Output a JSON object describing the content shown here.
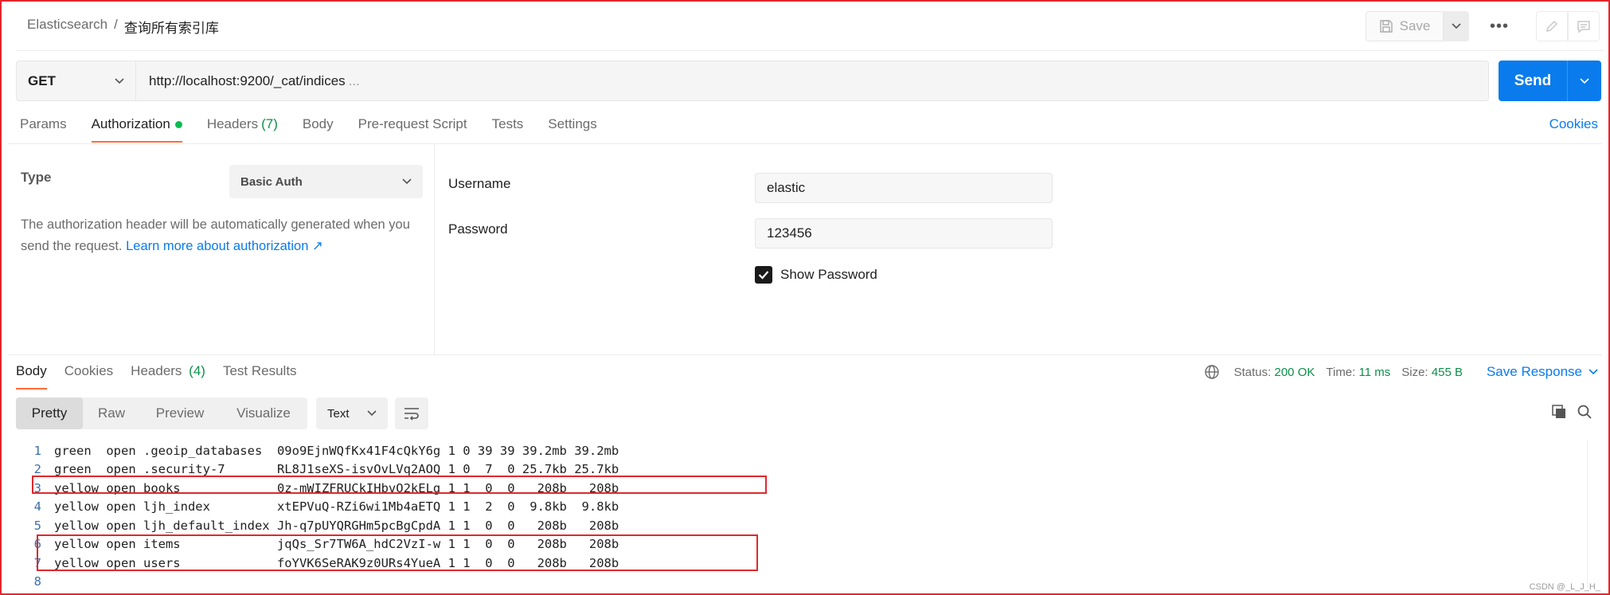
{
  "header": {
    "collection": "Elasticsearch",
    "separator": "/",
    "request_name": "查询所有索引库",
    "save_label": "Save",
    "more_label": "•••"
  },
  "request": {
    "method": "GET",
    "url": "http://localhost:9200/_cat/indices",
    "url_ellipsis": "...",
    "send_label": "Send"
  },
  "req_tabs": [
    {
      "label": "Params"
    },
    {
      "label": "Authorization",
      "active": true,
      "dot": true
    },
    {
      "label": "Headers",
      "count": "(7)"
    },
    {
      "label": "Body"
    },
    {
      "label": "Pre-request Script"
    },
    {
      "label": "Tests"
    },
    {
      "label": "Settings"
    }
  ],
  "cookies_label": "Cookies",
  "auth": {
    "type_label": "Type",
    "type_value": "Basic Auth",
    "description": "The authorization header will be automatically generated when you send the request. ",
    "learn_more": "Learn more about authorization ↗",
    "username_label": "Username",
    "username_value": "elastic",
    "password_label": "Password",
    "password_value": "123456",
    "show_password_label": "Show Password",
    "show_password_checked": true
  },
  "response": {
    "tabs": [
      {
        "label": "Body",
        "active": true
      },
      {
        "label": "Cookies"
      },
      {
        "label": "Headers",
        "count": "(4)"
      },
      {
        "label": "Test Results"
      }
    ],
    "status_label": "Status:",
    "status_value": "200 OK",
    "time_label": "Time:",
    "time_value": "11 ms",
    "size_label": "Size:",
    "size_value": "455 B",
    "save_response_label": "Save Response",
    "views": [
      "Pretty",
      "Raw",
      "Preview",
      "Visualize"
    ],
    "active_view": "Pretty",
    "format": "Text",
    "lines": [
      {
        "n": "1",
        "text": "green  open .geoip_databases  09o9EjnWQfKx41F4cQkY6g 1 0 39 39 39.2mb 39.2mb"
      },
      {
        "n": "2",
        "text": "green  open .security-7       RL8J1seXS-isvOvLVq2AOQ 1 0  7  0 25.7kb 25.7kb"
      },
      {
        "n": "3",
        "text": "yellow open books             0z-mWIZFRUCkIHbvO2kELg 1 1  0  0   208b   208b"
      },
      {
        "n": "4",
        "text": "yellow open ljh_index         xtEPVuQ-RZi6wi1Mb4aETQ 1 1  2  0  9.8kb  9.8kb"
      },
      {
        "n": "5",
        "text": "yellow open ljh_default_index Jh-q7pUYQRGHm5pcBgCpdA 1 1  0  0   208b   208b"
      },
      {
        "n": "6",
        "text": "yellow open items             jqQs_Sr7TW6A_hdC2VzI-w 1 1  0  0   208b   208b"
      },
      {
        "n": "7",
        "text": "yellow open users             foYVK6SeRAK9z0URs4YueA 1 1  0  0   208b   208b"
      },
      {
        "n": "8",
        "text": ""
      }
    ]
  },
  "watermark": "CSDN @_L_J_H_",
  "colors": {
    "accent_orange": "#ff6c37",
    "send_blue": "#097bed",
    "status_green": "#0d8f4a",
    "annotation_red": "#e0282d"
  }
}
